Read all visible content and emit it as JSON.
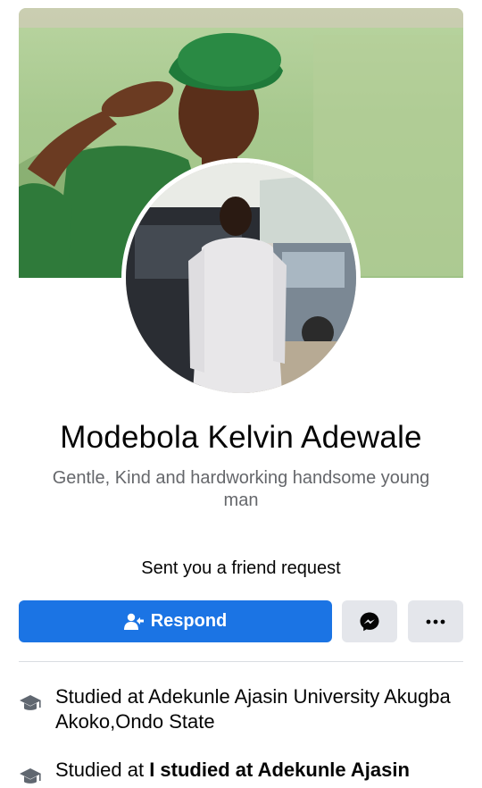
{
  "profile": {
    "name": "Modebola Kelvin Adewale",
    "bio": "Gentle, Kind and hardworking handsome young man",
    "friend_request_text": "Sent you a friend request"
  },
  "actions": {
    "respond_label": "Respond",
    "more_label": "···"
  },
  "info": [
    {
      "prefix": "Studied at Adekunle Ajasin University Akugba Akoko,Ondo State",
      "bold": ""
    },
    {
      "prefix": "Studied at ",
      "bold": "I studied at Adekunle Ajasin"
    }
  ],
  "colors": {
    "primary_button": "#1b74e4",
    "secondary_button": "#e4e6eb",
    "secondary_text": "#65676b",
    "icon_gray": "#606770"
  },
  "icons": {
    "respond": "person-reply-icon",
    "messenger": "messenger-icon",
    "more": "more-dots-icon",
    "education": "graduation-cap-icon"
  }
}
